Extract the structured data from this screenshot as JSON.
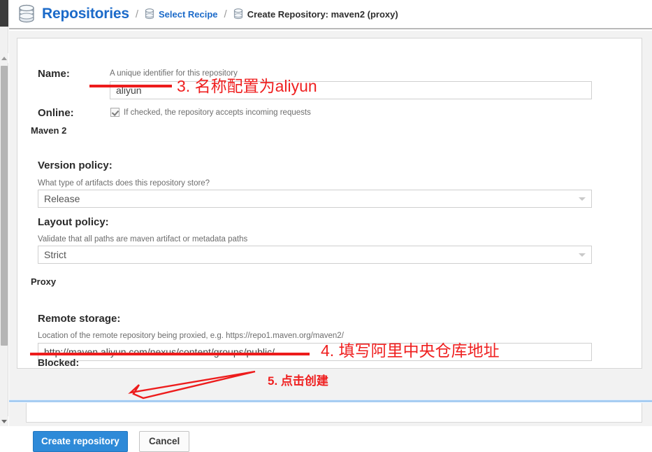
{
  "header": {
    "root_icon": "database-icon",
    "root_label": "Repositories",
    "separator": "/",
    "recipe_icon": "database-icon",
    "recipe_label": "Select Recipe",
    "current_icon": "database-icon",
    "current_label": "Create Repository: maven2 (proxy)"
  },
  "form": {
    "name": {
      "label": "Name:",
      "hint": "A unique identifier for this repository",
      "value": "aliyun",
      "placeholder": ""
    },
    "online": {
      "label": "Online:",
      "checkbox_checked": true,
      "hint": "If checked, the repository accepts incoming requests"
    },
    "maven_section": {
      "title": "Maven 2",
      "version_policy": {
        "label": "Version policy:",
        "hint": "What type of artifacts does this repository store?",
        "value": "Release",
        "icon": "chevron-down-icon"
      },
      "layout_policy": {
        "label": "Layout policy:",
        "hint": "Validate that all paths are maven artifact or metadata paths",
        "value": "Strict",
        "icon": "chevron-down-icon"
      }
    },
    "proxy_section": {
      "title": "Proxy",
      "remote_storage": {
        "label": "Remote storage:",
        "hint": "Location of the remote repository being proxied, e.g. https://repo1.maven.org/maven2/",
        "value": "http://maven.aliyun.com/nexus/content/groups/public/",
        "placeholder": ""
      },
      "blocked": {
        "label": "Blocked:"
      }
    }
  },
  "footer": {
    "create_label": "Create repository",
    "cancel_label": "Cancel"
  },
  "annotations": {
    "step3": "3. 名称配置为aliyun",
    "step4": "4. 填写阿里中央仓库地址",
    "step5": "5. 点击创建",
    "color": "#ed1c1c"
  },
  "scrollbar": {
    "up_icon": "scroll-up-arrow-icon",
    "down_icon": "scroll-down-arrow-icon"
  }
}
